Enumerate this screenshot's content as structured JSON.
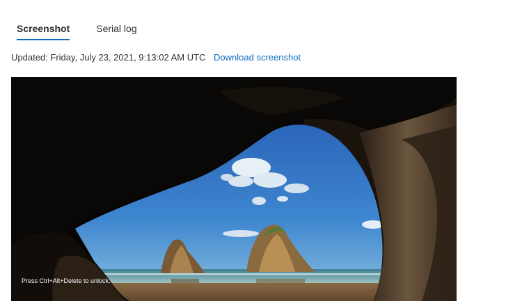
{
  "tabs": [
    {
      "label": "Screenshot",
      "active": true
    },
    {
      "label": "Serial log",
      "active": false
    }
  ],
  "status": {
    "updated": "Updated: Friday, July 23, 2021, 9:13:02 AM UTC",
    "download_label": "Download screenshot"
  },
  "screenshot": {
    "lock_message": "Press Ctrl+Alt+Delete to unlock."
  },
  "colors": {
    "accent": "#0f6cbd",
    "text": "#323130"
  }
}
